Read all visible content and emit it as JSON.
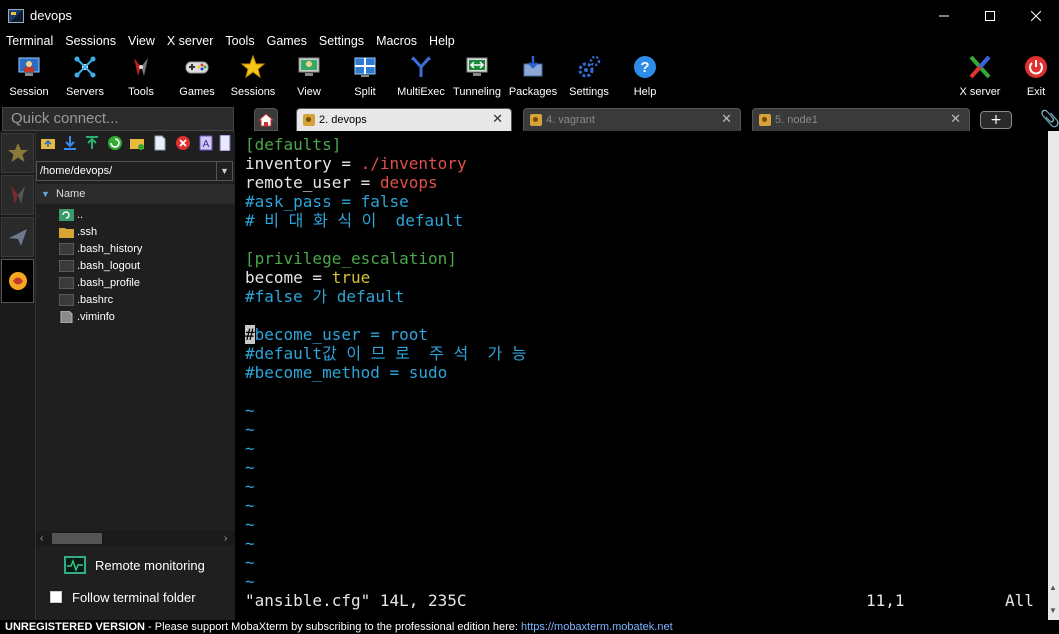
{
  "window": {
    "title": "devops"
  },
  "window_controls": [
    "minimize",
    "maximize",
    "close"
  ],
  "menu": [
    "Terminal",
    "Sessions",
    "View",
    "X server",
    "Tools",
    "Games",
    "Settings",
    "Macros",
    "Help"
  ],
  "toolbar": {
    "items": [
      {
        "label": "Session",
        "icon": "session-icon"
      },
      {
        "label": "Servers",
        "icon": "servers-icon"
      },
      {
        "label": "Tools",
        "icon": "tools-icon"
      },
      {
        "label": "Games",
        "icon": "gamepad-icon"
      },
      {
        "label": "Sessions",
        "icon": "star-icon"
      },
      {
        "label": "View",
        "icon": "view-icon"
      },
      {
        "label": "Split",
        "icon": "split-icon"
      },
      {
        "label": "MultiExec",
        "icon": "multiexec-icon"
      },
      {
        "label": "Tunneling",
        "icon": "tunneling-icon"
      },
      {
        "label": "Packages",
        "icon": "packages-icon"
      },
      {
        "label": "Settings",
        "icon": "gear-icon"
      },
      {
        "label": "Help",
        "icon": "help-icon"
      }
    ],
    "xserver_label": "X server",
    "exit_label": "Exit"
  },
  "quick_connect": {
    "placeholder": "Quick connect..."
  },
  "tabs": [
    {
      "label": "2. devops",
      "active": true
    },
    {
      "label": "4. vagrant",
      "active": false
    },
    {
      "label": "5. node1",
      "active": false
    }
  ],
  "file_browser": {
    "path": "/home/devops/",
    "column_header": "Name",
    "files": [
      {
        "name": "..",
        "type": "parent"
      },
      {
        "name": ".ssh",
        "type": "folder"
      },
      {
        "name": ".bash_history",
        "type": "file"
      },
      {
        "name": ".bash_logout",
        "type": "file"
      },
      {
        "name": ".bash_profile",
        "type": "file"
      },
      {
        "name": ".bashrc",
        "type": "file"
      },
      {
        "name": ".viminfo",
        "type": "doc"
      }
    ],
    "remote_monitoring_label": "Remote monitoring",
    "follow_folder_label": "Follow terminal folder"
  },
  "terminal": {
    "lines": [
      [
        {
          "t": "[defaults]",
          "c": "green"
        }
      ],
      [
        {
          "t": "inventory",
          "c": "white"
        },
        {
          "t": " = ",
          "c": "white"
        },
        {
          "t": "./inventory",
          "c": "red"
        }
      ],
      [
        {
          "t": "remote_user",
          "c": "white"
        },
        {
          "t": " = ",
          "c": "white"
        },
        {
          "t": "devops",
          "c": "red"
        }
      ],
      [
        {
          "t": "#ask_pass = false",
          "c": "blue"
        }
      ],
      [
        {
          "t": "# 비 대 화 식 이  default",
          "c": "blue"
        }
      ],
      [],
      [
        {
          "t": "[privilege_escalation]",
          "c": "green"
        }
      ],
      [
        {
          "t": "become",
          "c": "white"
        },
        {
          "t": " = ",
          "c": "white"
        },
        {
          "t": "true",
          "c": "yellow"
        }
      ],
      [
        {
          "t": "#false 가 default",
          "c": "blue"
        }
      ],
      [],
      [
        {
          "t": "#",
          "c": "cursor"
        },
        {
          "t": "become_user = root",
          "c": "blue"
        }
      ],
      [
        {
          "t": "#default값 이 므 로  주 석  가 능",
          "c": "blue"
        }
      ],
      [
        {
          "t": "#become_method = sudo",
          "c": "blue"
        }
      ],
      [],
      [
        {
          "t": "~",
          "c": "blue"
        }
      ],
      [
        {
          "t": "~",
          "c": "blue"
        }
      ],
      [
        {
          "t": "~",
          "c": "blue"
        }
      ],
      [
        {
          "t": "~",
          "c": "blue"
        }
      ],
      [
        {
          "t": "~",
          "c": "blue"
        }
      ],
      [
        {
          "t": "~",
          "c": "blue"
        }
      ],
      [
        {
          "t": "~",
          "c": "blue"
        }
      ],
      [
        {
          "t": "~",
          "c": "blue"
        }
      ],
      [
        {
          "t": "~",
          "c": "blue"
        }
      ],
      [
        {
          "t": "~",
          "c": "blue"
        }
      ]
    ],
    "status_file": "\"ansible.cfg\" 14L, 235C",
    "status_pos": "11,1",
    "status_scroll": "All"
  },
  "bottom_bar": {
    "unregistered": "UNREGISTERED VERSION",
    "message": " -  Please support MobaXterm by subscribing to the professional edition here:  ",
    "link": "https://mobaxterm.mobatek.net"
  }
}
